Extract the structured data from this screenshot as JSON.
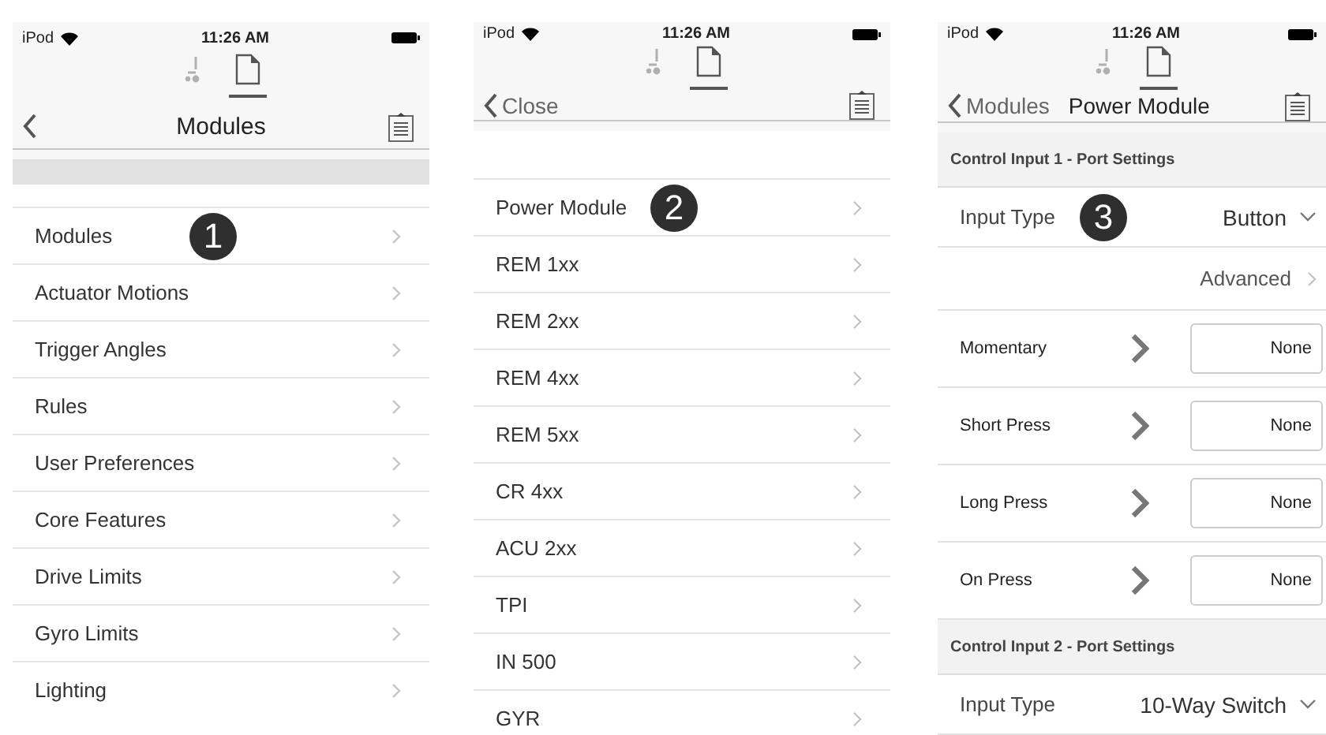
{
  "screens": [
    {
      "status_bar": {
        "carrier": "iPod",
        "time": "11:26 AM"
      },
      "tabs": [
        {
          "kind": "wheelchair",
          "selected": false
        },
        {
          "kind": "document",
          "selected": true
        }
      ],
      "nav": {
        "title": "Modules"
      },
      "grey_band": true,
      "items": [
        {
          "label": "Modules",
          "callout": "1"
        },
        {
          "label": "Actuator Motions"
        },
        {
          "label": "Trigger Angles"
        },
        {
          "label": "Rules"
        },
        {
          "label": "User Preferences"
        },
        {
          "label": "Core Features"
        },
        {
          "label": "Drive Limits"
        },
        {
          "label": "Gyro Limits"
        },
        {
          "label": "Lighting"
        }
      ]
    },
    {
      "status_bar": {
        "carrier": "iPod",
        "time": "11:26 AM"
      },
      "tabs": [
        {
          "kind": "wheelchair",
          "selected": false
        },
        {
          "kind": "document",
          "selected": true
        }
      ],
      "nav": {
        "back": "Close"
      },
      "items": [
        {
          "label": "Power Module",
          "callout": "2"
        },
        {
          "label": "REM 1xx"
        },
        {
          "label": "REM 2xx"
        },
        {
          "label": "REM 4xx"
        },
        {
          "label": "REM 5xx"
        },
        {
          "label": "CR 4xx"
        },
        {
          "label": "ACU 2xx"
        },
        {
          "label": "TPI"
        },
        {
          "label": "IN 500"
        },
        {
          "label": "GYR"
        }
      ]
    },
    {
      "status_bar": {
        "carrier": "iPod",
        "time": "11:26 AM"
      },
      "tabs": [
        {
          "kind": "wheelchair",
          "selected": false
        },
        {
          "kind": "document",
          "selected": true
        }
      ],
      "nav": {
        "back": "Modules",
        "title": "Power Module"
      },
      "sections": [
        {
          "header": "Control Input 1 - Port Settings",
          "rows": [
            {
              "kind": "select",
              "label": "Input Type",
              "value": "Button",
              "callout": "3"
            },
            {
              "kind": "link",
              "value": "Advanced"
            },
            {
              "kind": "action",
              "label": "Momentary",
              "value": "None"
            },
            {
              "kind": "action",
              "label": "Short Press",
              "value": "None"
            },
            {
              "kind": "action",
              "label": "Long Press",
              "value": "None"
            },
            {
              "kind": "action",
              "label": "On Press",
              "value": "None"
            }
          ]
        },
        {
          "header": "Control Input 2 - Port Settings",
          "rows": [
            {
              "kind": "select",
              "label": "Input Type",
              "value": "10-Way Switch"
            }
          ]
        }
      ]
    }
  ]
}
